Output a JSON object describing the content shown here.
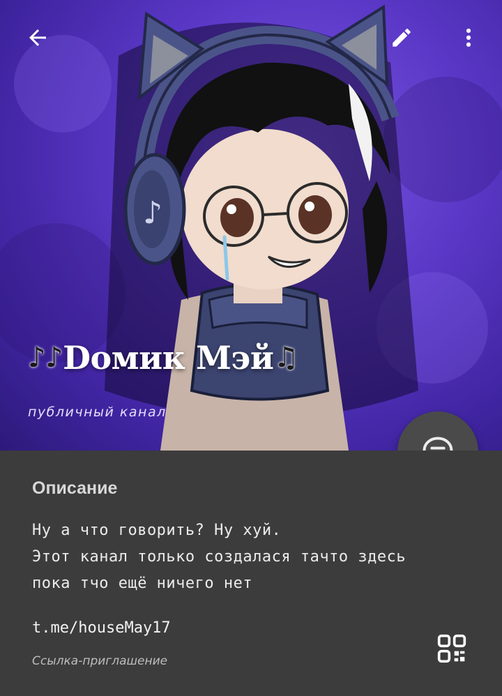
{
  "header": {
    "back_icon": "arrow-left-icon",
    "edit_icon": "pencil-icon",
    "more_icon": "vertical-dots-icon",
    "title_prefix_glyph": "♪♪",
    "title": "Dомик Мэй",
    "title_suffix_glyph": "♫",
    "subtitle": "публичный канал",
    "accent_color": "#5b38c7"
  },
  "fab": {
    "icon": "chat-bubble-icon"
  },
  "info": {
    "section_title": "Описание",
    "description_lines": [
      "Ну а что говорить? Ну хуй.",
      "Этот канал только создалася тачто здесь",
      "пока тчо ещё ничего нет"
    ],
    "link": "t.me/houseMay17",
    "link_caption": "Ссылка-приглашение",
    "qr_icon": "qr-code-icon"
  }
}
